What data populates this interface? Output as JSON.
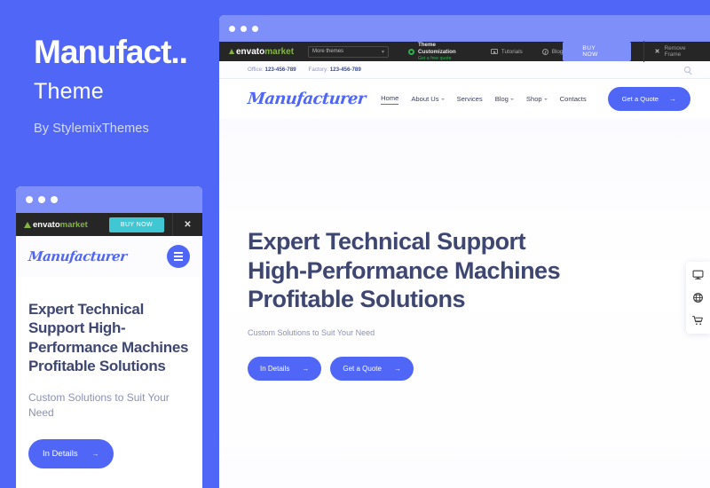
{
  "promo": {
    "title": "Manufact..",
    "subtitle": "Theme",
    "author": "By StylemixThemes"
  },
  "colors": {
    "page_background": "#4f66f7",
    "titlebar": "#7f8ff9",
    "brand_blue": "#4f66f7",
    "envato_bar": "#262626",
    "envato_green": "#82b541",
    "mobile_buy_now": "#3fc8d4",
    "heading_navy": "#3e4672"
  },
  "envato_bar": {
    "logo_primary": "envato",
    "logo_secondary": "market",
    "more_themes_label": "More themes",
    "more_themes_caret": "chevron-down-icon",
    "theme_customization_title": "Theme Customization",
    "theme_customization_sub": "Get a free quote",
    "tutorials_label": "Tutorials",
    "blog_label": "Blog",
    "buy_now_label": "BUY NOW",
    "remove_frame_label": "Remove Frame",
    "remove_frame_glyph": "✕"
  },
  "mobile_envato_bar": {
    "buy_now_label": "BUY NOW",
    "close_glyph": "✕"
  },
  "site": {
    "logo_text": "Manufacturer",
    "contact": {
      "office_label": "Office:",
      "office_phone": "123-456-789",
      "factory_label": "Factory:",
      "factory_phone": "123-456-789",
      "search_icon": "search-icon"
    },
    "nav": [
      {
        "label": "Home",
        "has_caret": false,
        "active": true
      },
      {
        "label": "About Us",
        "has_caret": true,
        "active": false
      },
      {
        "label": "Services",
        "has_caret": false,
        "active": false
      },
      {
        "label": "Blog",
        "has_caret": true,
        "active": false
      },
      {
        "label": "Shop",
        "has_caret": true,
        "active": false
      },
      {
        "label": "Contacts",
        "has_caret": false,
        "active": false
      }
    ],
    "quote_button": {
      "label": "Get a Quote",
      "arrow": "→"
    }
  },
  "hero": {
    "line1": "Expert Technical Support",
    "line2": "High-Performance Machines",
    "line3": "Profitable Solutions",
    "subtitle": "Custom Solutions to Suit Your Need",
    "buttons": [
      {
        "label": "In Details",
        "arrow": "→"
      },
      {
        "label": "Get a Quote",
        "arrow": "→"
      }
    ]
  },
  "mobile_hero": {
    "heading": "Expert Technical Support High-Performance Machines Profitable Solutions",
    "subtitle": "Custom Solutions to Suit Your Need",
    "button": {
      "label": "In Details",
      "arrow": "→"
    }
  },
  "dock": [
    {
      "icon": "monitor-icon"
    },
    {
      "icon": "globe-icon"
    },
    {
      "icon": "cart-icon"
    }
  ]
}
